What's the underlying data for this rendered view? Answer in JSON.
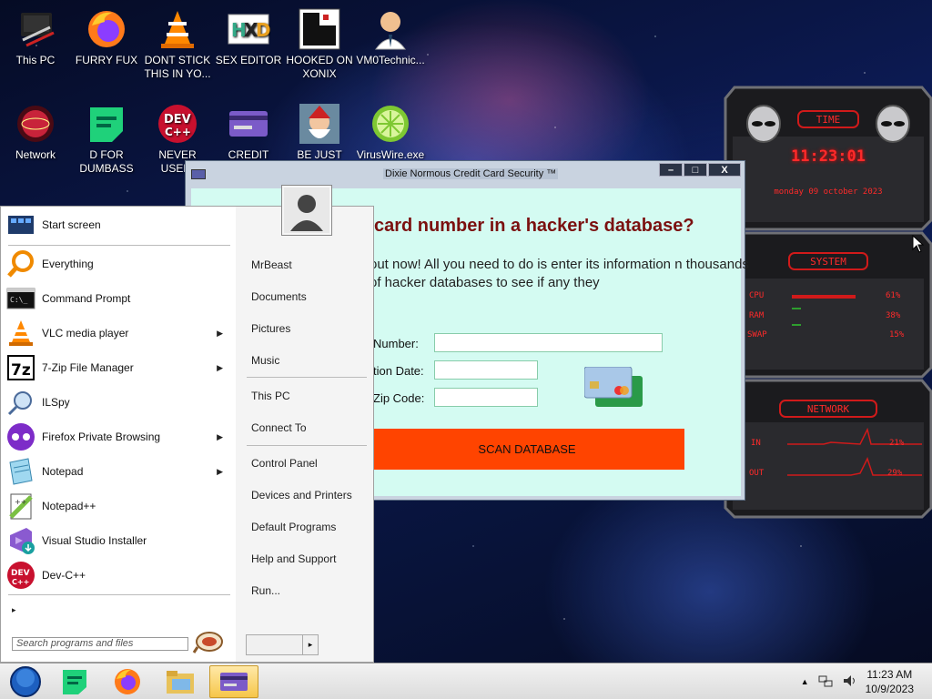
{
  "desktop": {
    "icons": [
      {
        "label": "This PC",
        "icon": "this-pc-icon"
      },
      {
        "label": "FURRY FUX",
        "icon": "firefox-icon"
      },
      {
        "label": "DONT STICK THIS IN YO...",
        "icon": "vlc-cone-icon"
      },
      {
        "label": "SEX EDITOR",
        "icon": "hxd-editor-icon"
      },
      {
        "label": "HOOKED ON XONIX",
        "icon": "xonix-game-icon"
      },
      {
        "label": "VM0Technic...",
        "icon": "doctor-icon"
      },
      {
        "label": "Network",
        "icon": "network-icon"
      },
      {
        "label": "D FOR DUMBASS",
        "icon": "green-d-icon"
      },
      {
        "label": "NEVER USED!",
        "icon": "devcpp-icon"
      },
      {
        "label": "CREDIT CARD CHECKER",
        "icon": "credit-card-icon"
      },
      {
        "label": "BE JUST LIKE THE DUDE!",
        "icon": "santa-icon"
      },
      {
        "label": "VirusWire.exe",
        "icon": "lime-icon"
      }
    ]
  },
  "app_window": {
    "title": "Dixie Normous Credit Card Security ™",
    "heading": "card number in a hacker's database?",
    "description": "out now! All you need to do is enter its information n thousands of hacker databases to see if any they",
    "fields": [
      {
        "label": "Number:"
      },
      {
        "label": "tion Date:"
      },
      {
        "label": "Zip Code:"
      }
    ],
    "button": "SCAN DATABASE",
    "controls": {
      "minimize": "–",
      "maximize": "□",
      "close": "X"
    }
  },
  "gadget": {
    "time_title": "TIME",
    "time": "11:23:01",
    "date": "monday 09 october 2023",
    "system_title": "SYSTEM",
    "system_rows": [
      {
        "label": "CPU",
        "value": "61%"
      },
      {
        "label": "RAM",
        "value": "38%"
      },
      {
        "label": "SWAP",
        "value": "15%"
      }
    ],
    "network_title": "NETWORK",
    "network_rows": [
      {
        "label": "IN",
        "value": "21%"
      },
      {
        "label": "OUT",
        "value": "29%"
      }
    ]
  },
  "start_menu": {
    "items": [
      {
        "label": "Start screen",
        "icon": "start-screen-icon",
        "arrow": false
      },
      {
        "label": "Everything",
        "icon": "everything-search-icon",
        "arrow": false
      },
      {
        "label": "Command Prompt",
        "icon": "command-prompt-icon",
        "arrow": false
      },
      {
        "label": "VLC media player",
        "icon": "vlc-icon",
        "arrow": true
      },
      {
        "label": "7-Zip File Manager",
        "icon": "7zip-icon",
        "arrow": true
      },
      {
        "label": "ILSpy",
        "icon": "ilspy-icon",
        "arrow": false
      },
      {
        "label": "Firefox Private Browsing",
        "icon": "firefox-private-icon",
        "arrow": true
      },
      {
        "label": "Notepad",
        "icon": "notepad-icon",
        "arrow": true
      },
      {
        "label": "Notepad++",
        "icon": "notepadpp-icon",
        "arrow": false
      },
      {
        "label": "Visual Studio Installer",
        "icon": "vs-installer-icon",
        "arrow": false
      },
      {
        "label": "Dev-C++",
        "icon": "devcpp-icon",
        "arrow": false
      }
    ],
    "all_programs_arrow": "▸",
    "search_placeholder": "Search programs and files",
    "right_items": [
      "MrBeast",
      "Documents",
      "Pictures",
      "Music",
      "This PC",
      "Connect To",
      "Control Panel",
      "Devices and Printers",
      "Default Programs",
      "Help and Support",
      "Run..."
    ],
    "shutdown_arrow": "▸"
  },
  "taskbar": {
    "time": "11:23 AM",
    "date": "10/9/2023",
    "tray_arrow": "▲"
  }
}
